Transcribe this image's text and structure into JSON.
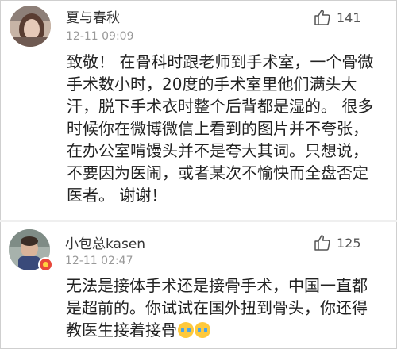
{
  "comments": [
    {
      "username": "夏与春秋",
      "time": "12-11 09:09",
      "likes": "141",
      "avatar_icon": "user-avatar",
      "lines": [
        "致敬！ 在骨科时跟老师到手术室，一个骨微",
        "手术数小时，20度的手术室里他们满头大",
        "汗，脱下手术衣时整个后背都是湿的。 很多",
        "时候你在微博微信上看到的图片并不夸张，",
        "在办公室啃馒头并不是夸大其词。只想说，",
        "不要因为医闹，或者某次不愉快而全盘否定",
        "医者。 谢谢！"
      ]
    },
    {
      "username": "小包总kasen",
      "time": "12-11 02:47",
      "likes": "125",
      "avatar_icon": "user-avatar",
      "badge_icon": "verified-badge-icon",
      "lines": [
        "无法是接体手术还是接骨手术，中国一直都",
        "是超前的。你试试在国外扭到骨头，你还得",
        "教医生接着接骨"
      ],
      "emojis": [
        "crying-emoji",
        "crying-emoji"
      ]
    }
  ],
  "colors": {
    "username": "#333333",
    "time": "#999999",
    "text": "#222222",
    "like": "#555555",
    "badge": "#e8473a"
  }
}
